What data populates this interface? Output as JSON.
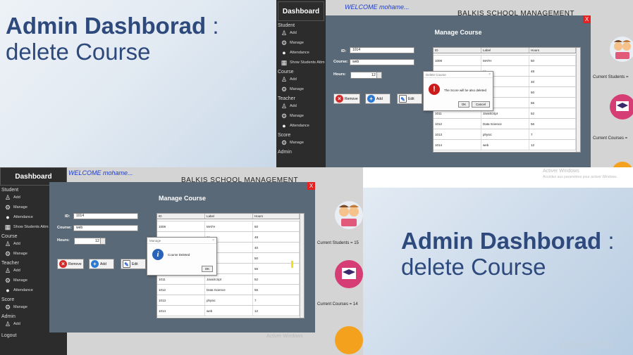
{
  "slide": {
    "title_bold": "Admin Dashborad",
    "title_colon": ":",
    "subtitle": "delete Course"
  },
  "app": {
    "dashboard_title": "Dashboard",
    "welcome": "WELCOME mohame...",
    "school_name": "BALKIS SCHOOL MANAGEMENT",
    "sidebar": {
      "student_section": "Student",
      "student_add": "Add",
      "student_manage": "Manage",
      "student_attendance": "Attendance",
      "show_students_attendance": "Show Students Attm",
      "course_section": "Course",
      "course_add": "Add",
      "course_manage": "Manage",
      "teacher_section": "Teacher",
      "teacher_add": "Add",
      "teacher_manage": "Manage",
      "teacher_attendance": "Attendance",
      "score_section": "Score",
      "score_manage": "Manage",
      "admin_section": "Admin",
      "admin_add": "Add",
      "logout": "Logout"
    },
    "manage_course": {
      "title": "Manage Course",
      "close": "X",
      "id_label": "ID:",
      "id_value": "1014",
      "course_label": "Course:",
      "course_value": "web",
      "hours_label": "Hours:",
      "hours_value": "12",
      "remove_label": "Remove",
      "add_label": "Add",
      "edit_label": "Edit"
    },
    "table": {
      "headers": [
        "ID",
        "Label",
        "Hours"
      ],
      "rows": [
        [
          "1009",
          "MATH",
          "50"
        ],
        [
          "",
          "se",
          "48"
        ],
        [
          "",
          "",
          "40"
        ],
        [
          "",
          "",
          "50"
        ],
        [
          "",
          "s Java",
          "56"
        ],
        [
          "1011",
          "JavaScript",
          "52"
        ],
        [
          "1012",
          "Data Science",
          "56"
        ],
        [
          "1013",
          "physic",
          "7"
        ],
        [
          "1014",
          "web",
          "12"
        ]
      ]
    },
    "confirm_dialog": {
      "title": "Delete Course",
      "close": "×",
      "message": "The Score will be also deleted",
      "ok": "OK",
      "cancel": "Cancel"
    },
    "info_dialog": {
      "title": "Manage",
      "close": "×",
      "message": "Course Deleted",
      "ok": "OK"
    },
    "stats": {
      "students_top": "Current Students =",
      "courses_top": "Current Courses =",
      "students_bottom": "Current Students = 15",
      "courses_bottom": "Current Courses = 14"
    },
    "watermark": {
      "title": "Activer Windows",
      "subtitle": "Accédez aux paramètres pour activer Windows.",
      "large": "Activer Win"
    }
  },
  "colors": {
    "title_blue": "#2e4a7d",
    "sidebar": "#2c2c2c",
    "panel": "#5a6977",
    "close_red": "#e52222",
    "welcome_blue": "#1e3cc8"
  }
}
